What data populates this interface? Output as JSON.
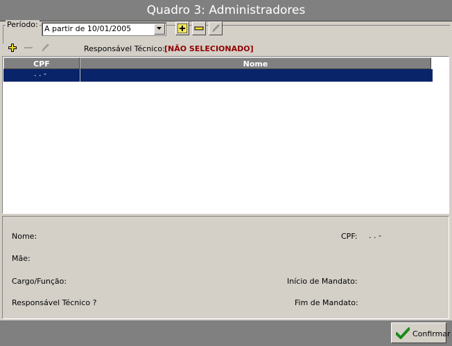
{
  "window": {
    "title": "Quadro 3: Administradores"
  },
  "periodo": {
    "label": "Período:",
    "selected": "A partir de 10/01/2005"
  },
  "responsavel": {
    "label": "Responsável Técnico:",
    "value": "[NÃO SELECIONADO]"
  },
  "grid": {
    "columns": [
      "CPF",
      "Nome"
    ],
    "rows": [
      {
        "cpf": ". . -",
        "nome": ""
      }
    ]
  },
  "detail": {
    "nome_label": "Nome:",
    "cpf_label": "CPF:",
    "cpf_value": ". . -",
    "mae_label": "Mãe:",
    "cargo_label": "Cargo/Função:",
    "inicio_label": "Início de Mandato:",
    "resp_label": "Responsável Técnico ?",
    "fim_label": "Fim de Mandato:"
  },
  "footer": {
    "confirm_label": "Confirmar"
  },
  "colors": {
    "selection": "#0a246a",
    "warning_text": "#900000",
    "titlebar": "#808080"
  }
}
